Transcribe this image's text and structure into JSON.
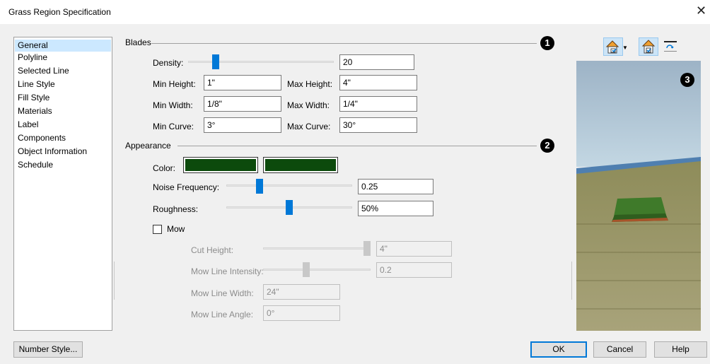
{
  "window": {
    "title": "Grass Region Specification",
    "close_glyph": "✕"
  },
  "sidebar": {
    "items": [
      {
        "label": "General",
        "selected": true
      },
      {
        "label": "Polyline"
      },
      {
        "label": "Selected Line"
      },
      {
        "label": "Line Style"
      },
      {
        "label": "Fill Style"
      },
      {
        "label": "Materials"
      },
      {
        "label": "Label"
      },
      {
        "label": "Components"
      },
      {
        "label": "Object Information"
      },
      {
        "label": "Schedule"
      }
    ]
  },
  "blades": {
    "title": "Blades",
    "badge": "1",
    "density": {
      "label": "Density:",
      "value": "20",
      "slider_fraction": 0.12
    },
    "min_height": {
      "label": "Min Height:",
      "value": "1\""
    },
    "max_height": {
      "label": "Max Height:",
      "value": "4\""
    },
    "min_width": {
      "label": "Min Width:",
      "value": "1/8\""
    },
    "max_width": {
      "label": "Max Width:",
      "value": "1/4\""
    },
    "min_curve": {
      "label": "Min Curve:",
      "value": "3°"
    },
    "max_curve": {
      "label": "Max Curve:",
      "value": "30°"
    }
  },
  "appearance": {
    "title": "Appearance",
    "badge": "2",
    "color": {
      "label": "Color:",
      "color1": "#0c4a0c",
      "color2": "#0c4a0c"
    },
    "noise_frequency": {
      "label": "Noise Frequency:",
      "value": "0.25",
      "slider_fraction": 0.3
    },
    "roughness": {
      "label": "Roughness:",
      "value": "50%",
      "slider_fraction": 0.5
    },
    "mow": {
      "label": "Mow",
      "checked": false
    },
    "cut_height": {
      "label": "Cut Height:",
      "value": "4\"",
      "slider_fraction": 1.0
    },
    "mow_line_intensity": {
      "label": "Mow Line Intensity:",
      "value": "0.2",
      "slider_fraction": 0.3
    },
    "mow_line_width": {
      "label": "Mow Line Width:",
      "value": "24\""
    },
    "mow_line_angle": {
      "label": "Mow Line Angle:",
      "value": "0°"
    }
  },
  "preview": {
    "badge": "3",
    "toolbar": [
      "camera-view-icon",
      "building-check-icon",
      "refresh-preview-icon"
    ]
  },
  "buttons": {
    "number_style": "Number Style...",
    "ok": "OK",
    "cancel": "Cancel",
    "help": "Help"
  },
  "colors": {
    "accent": "#0078d7",
    "selection": "#cce8ff",
    "grass": "#0c4a0c"
  }
}
